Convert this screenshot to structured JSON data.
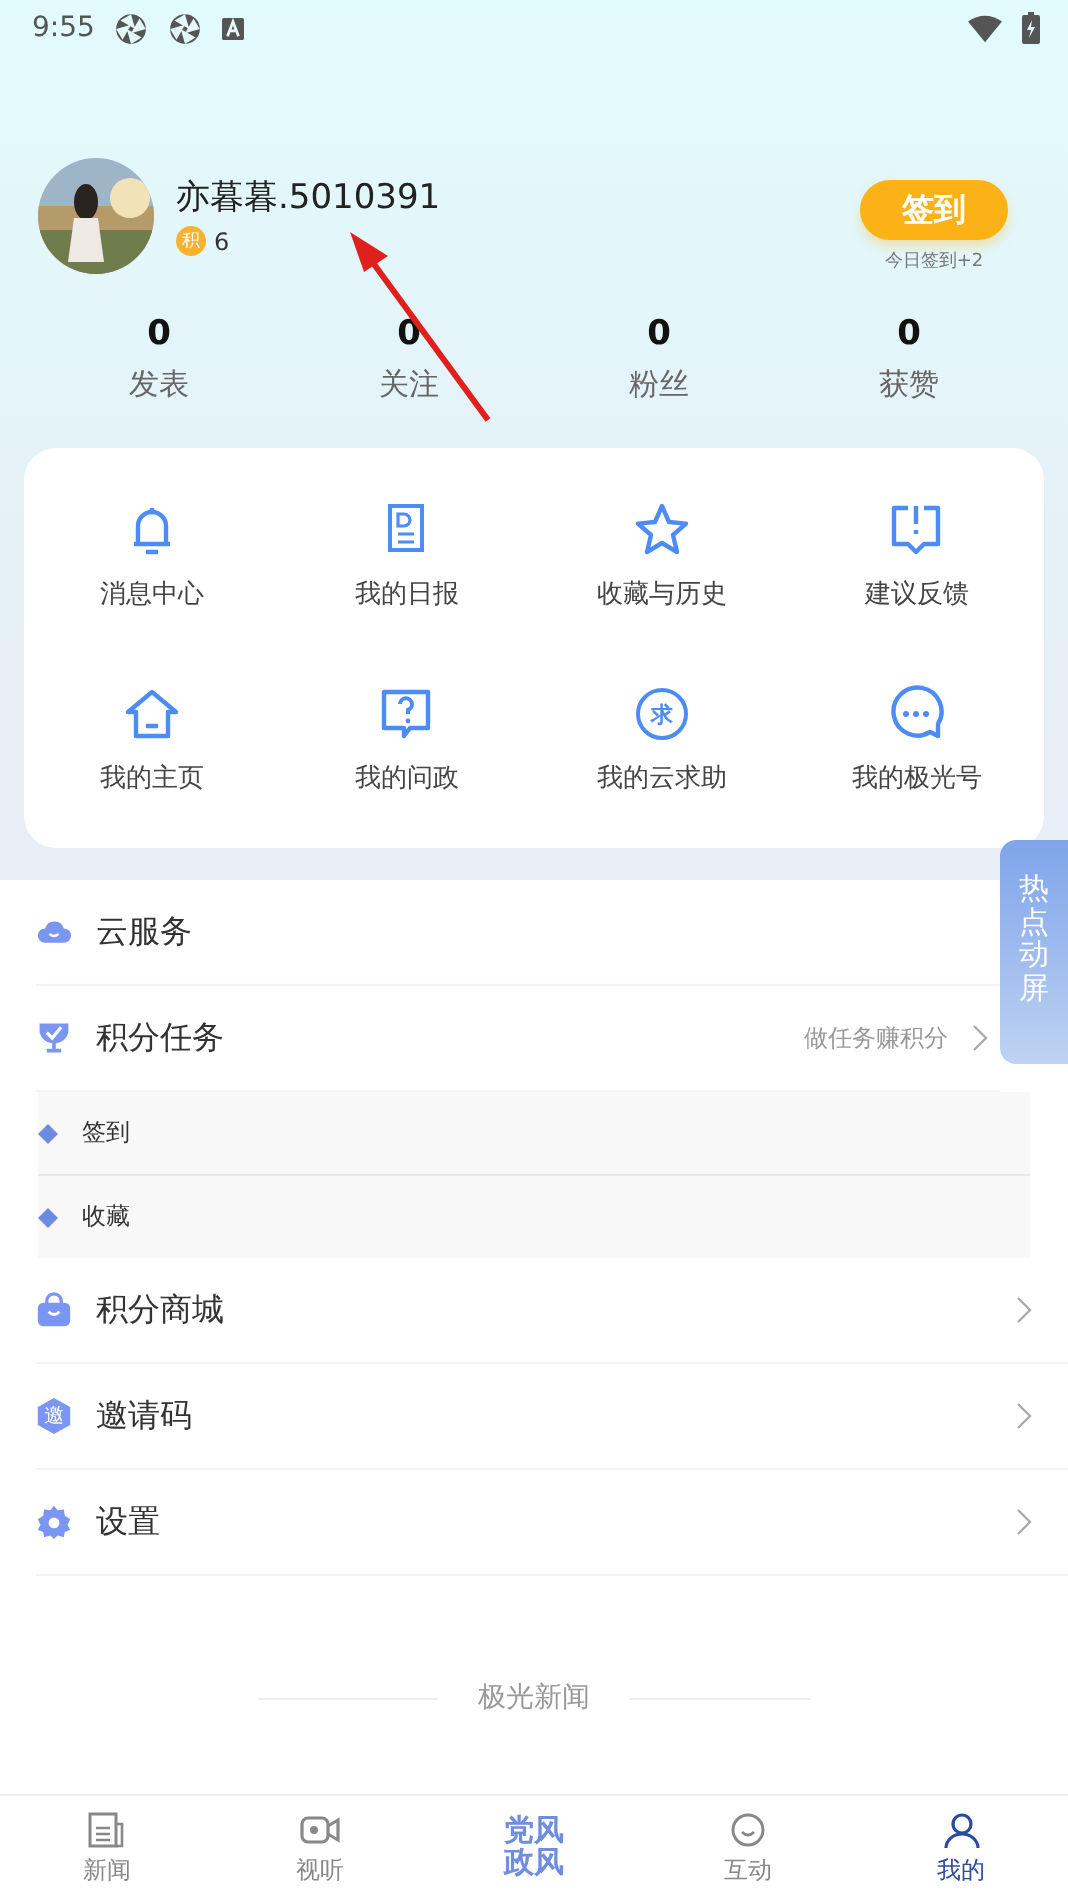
{
  "status_bar": {
    "time": "9:55"
  },
  "profile": {
    "name": "亦暮暮.5010391",
    "points_badge": "积",
    "points": "6",
    "checkin_button": "签到",
    "checkin_note": "今日签到+2"
  },
  "stats": [
    {
      "value": "0",
      "label": "发表"
    },
    {
      "value": "0",
      "label": "关注"
    },
    {
      "value": "0",
      "label": "粉丝"
    },
    {
      "value": "0",
      "label": "获赞"
    }
  ],
  "shortcuts": [
    {
      "kind": "bell",
      "label": "消息中心"
    },
    {
      "kind": "report",
      "label": "我的日报"
    },
    {
      "kind": "star",
      "label": "收藏与历史"
    },
    {
      "kind": "feedback",
      "label": "建议反馈"
    },
    {
      "kind": "home",
      "label": "我的主页"
    },
    {
      "kind": "question",
      "label": "我的问政"
    },
    {
      "kind": "help",
      "label": "我的云求助",
      "glyph": "求"
    },
    {
      "kind": "chat",
      "label": "我的极光号"
    }
  ],
  "menu": [
    {
      "kind": "cloud",
      "label": "云服务",
      "chevron": false
    },
    {
      "kind": "trophy",
      "label": "积分任务",
      "hint": "做任务赚积分",
      "chevron": true,
      "expanded": true,
      "children": [
        {
          "label": "签到"
        },
        {
          "label": "收藏"
        }
      ]
    },
    {
      "kind": "bag",
      "label": "积分商城",
      "chevron": true
    },
    {
      "kind": "invite",
      "label": "邀请码",
      "chevron": true,
      "glyph": "邀"
    },
    {
      "kind": "gear",
      "label": "设置",
      "chevron": true
    }
  ],
  "side_tab": "热点动屏",
  "footer": "极光新闻",
  "bottom_nav": [
    {
      "kind": "news",
      "label": "新闻",
      "selected": false
    },
    {
      "kind": "video",
      "label": "视听",
      "selected": false
    },
    {
      "kind": "logo",
      "label": "党风政风",
      "selected": false
    },
    {
      "kind": "chat",
      "label": "互动",
      "selected": false
    },
    {
      "kind": "person",
      "label": "我的",
      "selected": true
    }
  ]
}
